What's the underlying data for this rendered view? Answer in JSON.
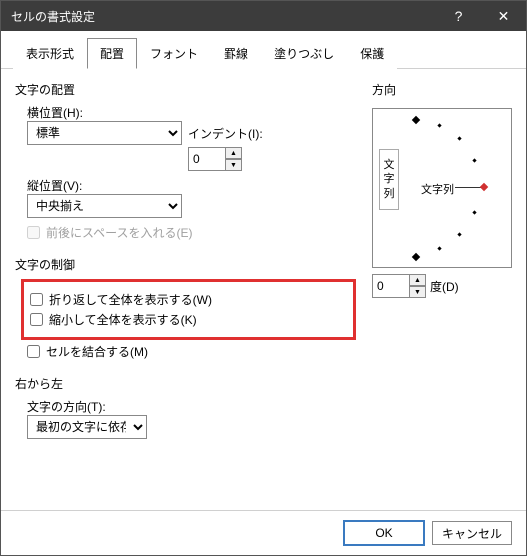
{
  "title": "セルの書式設定",
  "tabs": [
    "表示形式",
    "配置",
    "フォント",
    "罫線",
    "塗りつぶし",
    "保護"
  ],
  "active_tab": 1,
  "align": {
    "section": "文字の配置",
    "horiz_label": "横位置(H):",
    "horiz_value": "標準",
    "indent_label": "インデント(I):",
    "indent_value": "0",
    "vert_label": "縦位置(V):",
    "vert_value": "中央揃え",
    "justify_label": "前後にスペースを入れる(E)"
  },
  "control": {
    "section": "文字の制御",
    "wrap_label": "折り返して全体を表示する(W)",
    "shrink_label": "縮小して全体を表示する(K)",
    "merge_label": "セルを結合する(M)"
  },
  "rtl": {
    "section": "右から左",
    "dir_label": "文字の方向(T):",
    "dir_value": "最初の文字に依存"
  },
  "orient": {
    "section": "方向",
    "text_vert": "文字列",
    "text_horiz": "文字列",
    "deg_value": "0",
    "deg_label": "度(D)"
  },
  "buttons": {
    "ok": "OK",
    "cancel": "キャンセル"
  }
}
